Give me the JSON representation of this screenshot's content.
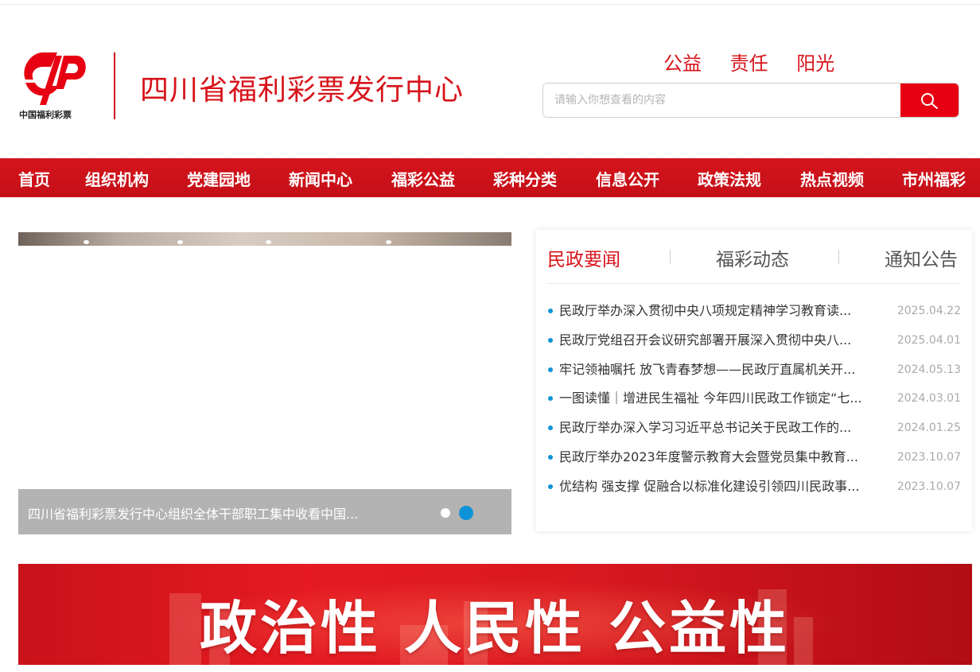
{
  "header": {
    "logo_text": "中国福利彩票",
    "site_title": "四川省福利彩票发行中心",
    "slogan": [
      "公益",
      "责任",
      "阳光"
    ],
    "search_placeholder": "请输入你想查看的内容"
  },
  "nav": {
    "items": [
      "首页",
      "组织机构",
      "党建园地",
      "新闻中心",
      "福彩公益",
      "彩种分类",
      "信息公开",
      "政策法规",
      "热点视频",
      "市州福彩"
    ]
  },
  "slider": {
    "caption": "四川省福利彩票发行中心组织全体干部职工集中收看中国...",
    "active_dot": 2
  },
  "news": {
    "tabs": [
      "民政要闻",
      "福彩动态",
      "通知公告"
    ],
    "items": [
      {
        "title": "民政厅举办深入贯彻中央八项规定精神学习教育读...",
        "date": "2025.04.22"
      },
      {
        "title": "民政厅党组召开会议研究部署开展深入贯彻中央八...",
        "date": "2025.04.01"
      },
      {
        "title": "牢记领袖嘱托 放飞青春梦想——民政厅直属机关开...",
        "date": "2024.05.13"
      },
      {
        "title": "一图读懂｜增进民生福祉 今年四川民政工作锁定“七...",
        "date": "2024.03.01"
      },
      {
        "title": "民政厅举办深入学习习近平总书记关于民政工作的...",
        "date": "2024.01.25"
      },
      {
        "title": "民政厅举办2023年度警示教育大会暨党员集中教育...",
        "date": "2023.10.07"
      },
      {
        "title": "优结构 强支撑 促融合以标准化建设引领四川民政事...",
        "date": "2023.10.07"
      }
    ]
  },
  "banner": {
    "text": "政治性 人民性 公益性"
  },
  "colors": {
    "brand_red": "#d7141b",
    "search_red": "#e60012",
    "accent_blue": "#0f93d8"
  }
}
